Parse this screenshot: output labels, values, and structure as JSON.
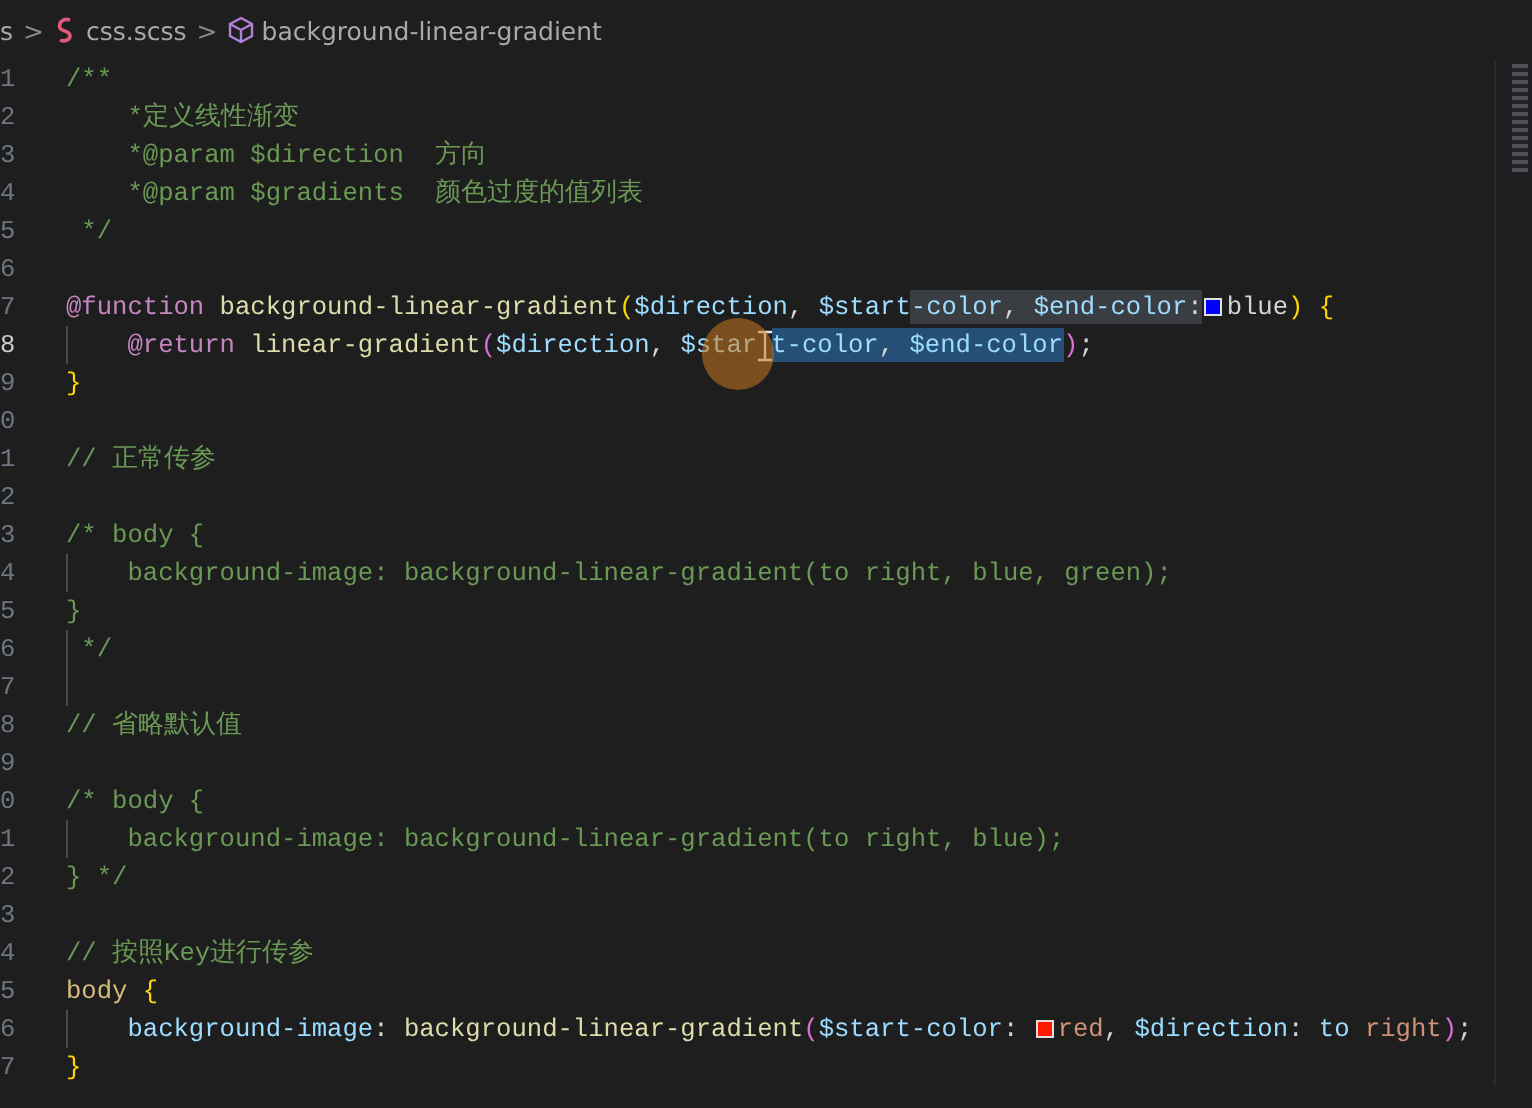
{
  "breadcrumb": {
    "items": [
      {
        "kind": "text",
        "text": "s"
      },
      {
        "kind": "separator",
        "text": ">"
      },
      {
        "kind": "file",
        "text": "css.scss"
      },
      {
        "kind": "separator",
        "text": ">"
      },
      {
        "kind": "symbol",
        "text": "background-linear-gradient"
      }
    ]
  },
  "editor": {
    "lines": [
      {
        "number": "1",
        "active": false,
        "guide": false,
        "tokens": [
          {
            "kind": "comment",
            "text": "/**"
          }
        ]
      },
      {
        "number": "2",
        "active": false,
        "guide": false,
        "tokens": [
          {
            "kind": "comment",
            "text": "    *定义线性渐变"
          }
        ]
      },
      {
        "number": "3",
        "active": false,
        "guide": false,
        "tokens": [
          {
            "kind": "comment",
            "text": "    *@param $direction  方向"
          }
        ]
      },
      {
        "number": "4",
        "active": false,
        "guide": false,
        "tokens": [
          {
            "kind": "comment",
            "text": "    *@param $gradients  颜色过度的值列表"
          }
        ]
      },
      {
        "number": "5",
        "active": false,
        "guide": false,
        "tokens": [
          {
            "kind": "comment",
            "text": " */"
          }
        ]
      },
      {
        "number": "6",
        "active": false,
        "guide": false
      },
      {
        "number": "7",
        "active": false,
        "guide": false,
        "tokens": [
          {
            "kind": "keyword",
            "text": "@function "
          },
          {
            "kind": "function",
            "text": "background-linear-gradient"
          },
          {
            "kind": "bracket",
            "text": "("
          },
          {
            "kind": "variable",
            "text": "$direction"
          },
          {
            "kind": "plain",
            "text": ", "
          },
          {
            "kind": "variable",
            "text": "$start"
          },
          {
            "kind": "match",
            "tokens": [
              {
                "kind": "variable",
                "text": "-color"
              },
              {
                "kind": "plain",
                "text": ", "
              },
              {
                "kind": "variable",
                "text": "$end-color"
              },
              {
                "kind": "plain",
                "text": ":"
              }
            ]
          },
          {
            "kind": "swatch",
            "color": "#0000ff"
          },
          {
            "kind": "plain",
            "text": "blue"
          },
          {
            "kind": "bracket",
            "text": ")"
          },
          {
            "kind": "bracket",
            "text": " {"
          }
        ]
      },
      {
        "number": "8",
        "active": true,
        "guide": true,
        "tokens": [
          {
            "kind": "keyword",
            "text": "    @return "
          },
          {
            "kind": "function",
            "text": "linear-gradient"
          },
          {
            "kind": "bracket-2",
            "text": "("
          },
          {
            "kind": "variable",
            "text": "$direction"
          },
          {
            "kind": "plain",
            "text": ", "
          },
          {
            "kind": "variable",
            "text": "$star"
          },
          {
            "kind": "caret"
          },
          {
            "kind": "selection",
            "tokens": [
              {
                "kind": "variable",
                "text": "t-color"
              },
              {
                "kind": "plain",
                "text": ", "
              },
              {
                "kind": "variable",
                "text": "$end-color"
              }
            ]
          },
          {
            "kind": "bracket-2",
            "text": ")"
          },
          {
            "kind": "plain",
            "text": ";"
          }
        ]
      },
      {
        "number": "9",
        "active": false,
        "guide": false,
        "tokens": [
          {
            "kind": "bracket",
            "text": "}"
          }
        ]
      },
      {
        "number": "0",
        "active": false,
        "guide": false
      },
      {
        "number": "1",
        "active": false,
        "guide": false,
        "tokens": [
          {
            "kind": "comment",
            "text": "// 正常传参"
          }
        ]
      },
      {
        "number": "2",
        "active": false,
        "guide": false
      },
      {
        "number": "3",
        "active": false,
        "guide": false,
        "tokens": [
          {
            "kind": "comment",
            "text": "/* body {"
          }
        ]
      },
      {
        "number": "4",
        "active": false,
        "guide": true,
        "tokens": [
          {
            "kind": "comment",
            "text": "    background-image: background-linear-gradient(to right, blue, green);"
          }
        ]
      },
      {
        "number": "5",
        "active": false,
        "guide": false,
        "tokens": [
          {
            "kind": "comment",
            "text": "}"
          }
        ]
      },
      {
        "number": "6",
        "active": false,
        "guide": true,
        "tokens": [
          {
            "kind": "comment",
            "text": " */"
          }
        ]
      },
      {
        "number": "7",
        "active": false,
        "guide": true
      },
      {
        "number": "8",
        "active": false,
        "guide": false,
        "tokens": [
          {
            "kind": "comment",
            "text": "// 省略默认值"
          }
        ]
      },
      {
        "number": "9",
        "active": false,
        "guide": false
      },
      {
        "number": "0",
        "active": false,
        "guide": false,
        "tokens": [
          {
            "kind": "comment",
            "text": "/* body {"
          }
        ]
      },
      {
        "number": "1",
        "active": false,
        "guide": true,
        "tokens": [
          {
            "kind": "comment",
            "text": "    background-image: background-linear-gradient(to right, blue);"
          }
        ]
      },
      {
        "number": "2",
        "active": false,
        "guide": false,
        "tokens": [
          {
            "kind": "comment",
            "text": "} */"
          }
        ]
      },
      {
        "number": "3",
        "active": false,
        "guide": false
      },
      {
        "number": "4",
        "active": false,
        "guide": false,
        "tokens": [
          {
            "kind": "comment",
            "text": "// 按照Key进行传参"
          }
        ]
      },
      {
        "number": "5",
        "active": false,
        "guide": false,
        "tokens": [
          {
            "kind": "selector",
            "text": "body "
          },
          {
            "kind": "bracket",
            "text": "{"
          }
        ]
      },
      {
        "number": "6",
        "active": false,
        "guide": true,
        "tokens": [
          {
            "kind": "property",
            "text": "    background-image"
          },
          {
            "kind": "plain",
            "text": ": "
          },
          {
            "kind": "function",
            "text": "background-linear-gradient"
          },
          {
            "kind": "bracket-2",
            "text": "("
          },
          {
            "kind": "variable",
            "text": "$start-color"
          },
          {
            "kind": "plain",
            "text": ": "
          },
          {
            "kind": "swatch",
            "color": "#ff1a00"
          },
          {
            "kind": "string",
            "text": "red"
          },
          {
            "kind": "plain",
            "text": ", "
          },
          {
            "kind": "variable",
            "text": "$direction"
          },
          {
            "kind": "plain",
            "text": ": "
          },
          {
            "kind": "constant",
            "text": "to "
          },
          {
            "kind": "string",
            "text": "right"
          },
          {
            "kind": "bracket-2",
            "text": ")"
          },
          {
            "kind": "plain",
            "text": ";"
          }
        ]
      },
      {
        "number": "7",
        "active": false,
        "guide": false,
        "tokens": [
          {
            "kind": "bracket",
            "text": "}"
          }
        ]
      }
    ]
  }
}
